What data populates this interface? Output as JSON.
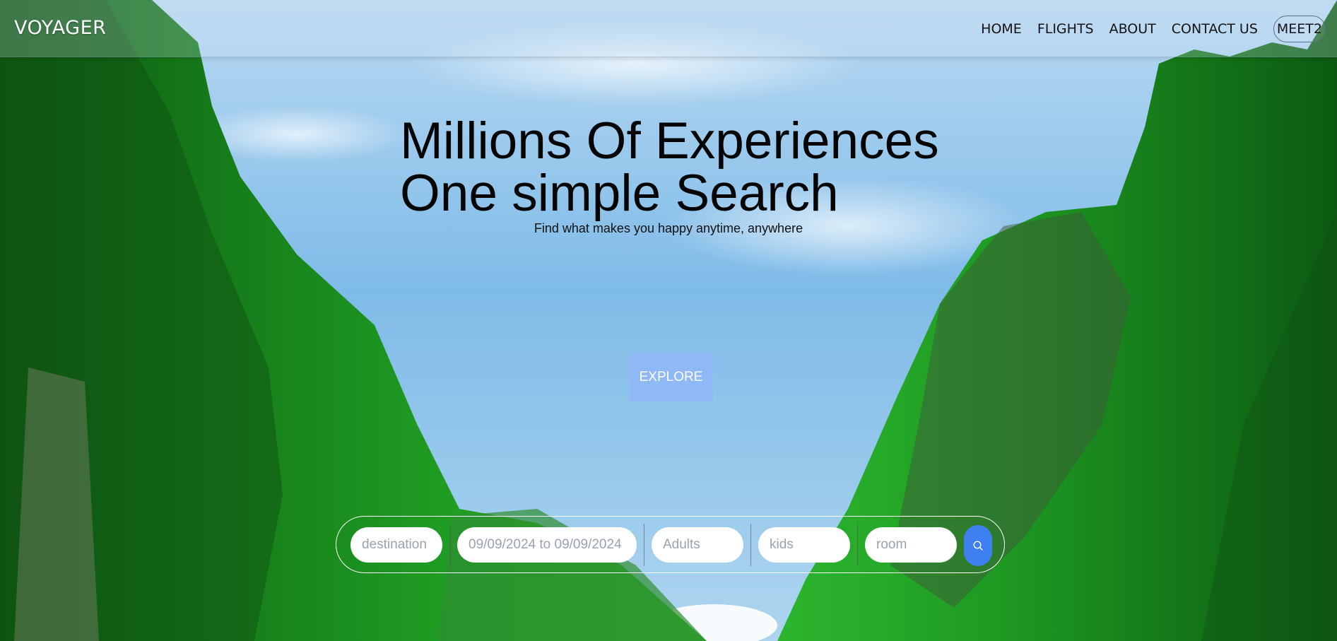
{
  "brand": "VOYAGER",
  "nav": {
    "links": [
      "HOME",
      "FLIGHTS",
      "ABOUT",
      "CONTACT US"
    ],
    "user": "MEET2"
  },
  "hero": {
    "line1": "Millions Of Experiences",
    "line2": "One simple Search",
    "subtitle": "Find what makes you happy anytime, anywhere"
  },
  "explore_label": "EXPLORE",
  "search": {
    "destination_placeholder": "destination",
    "date_placeholder": "09/09/2024 to 09/09/2024",
    "adults_placeholder": "Adults",
    "kids_placeholder": "kids",
    "room_placeholder": "room"
  },
  "colors": {
    "accent": "#3e80f0",
    "explore": "#8fb8f6",
    "sky": "#8ec3ea",
    "foliage": "#1f9a1f"
  },
  "icons": {
    "search_button": "search-icon"
  }
}
